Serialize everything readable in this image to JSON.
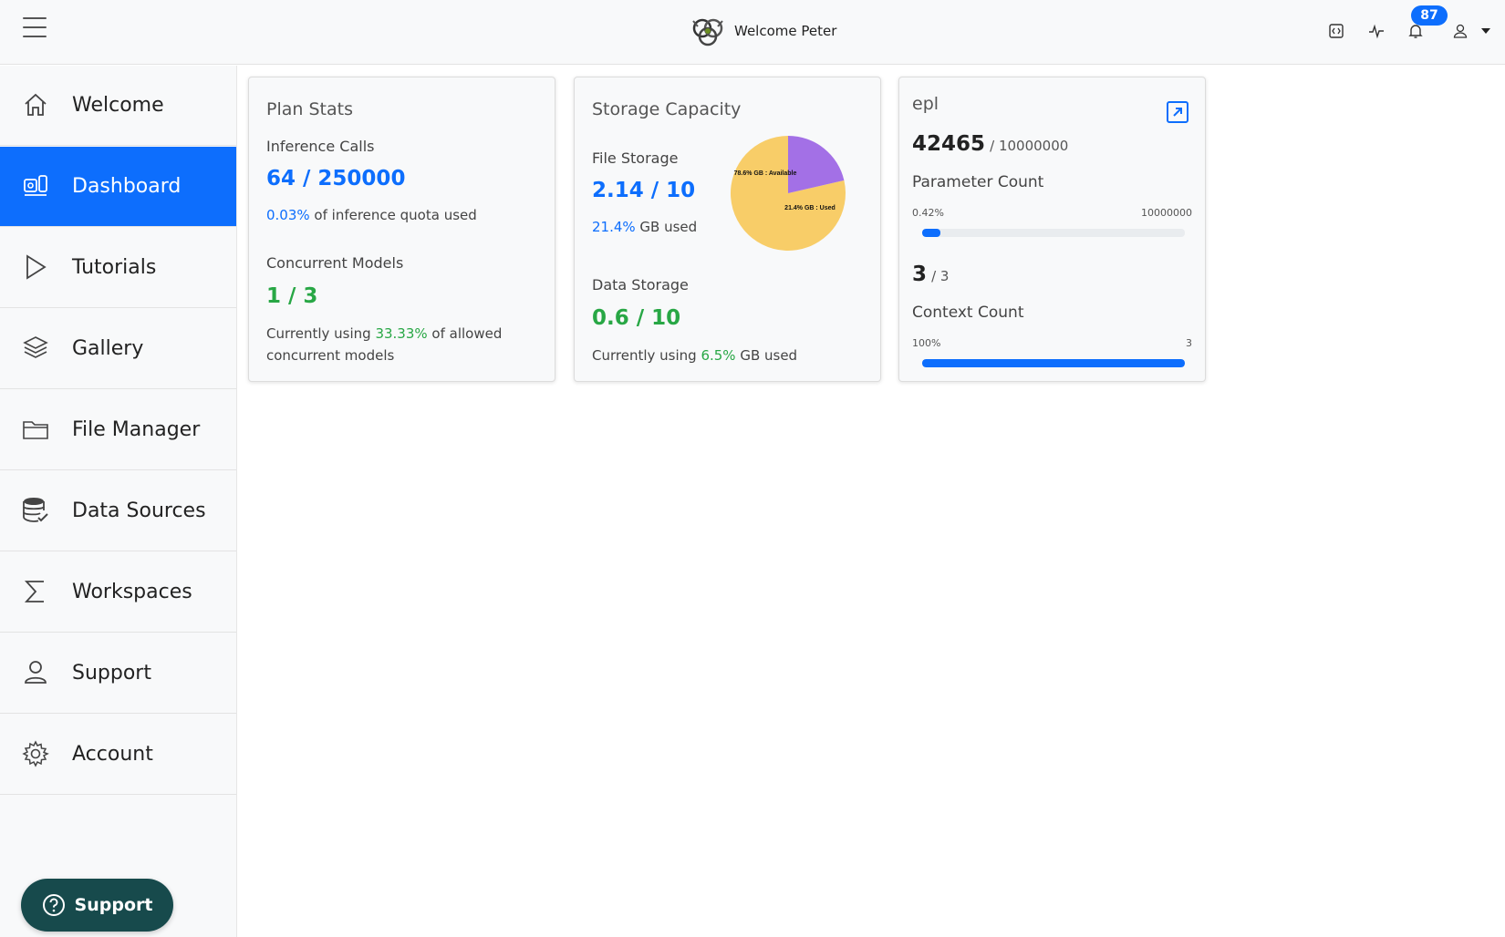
{
  "header": {
    "welcome_text": "Welcome Peter",
    "notification_count": "87",
    "accent_color": "#0d6efd"
  },
  "sidebar": {
    "items": [
      {
        "label": "Welcome",
        "icon": "home-icon"
      },
      {
        "label": "Dashboard",
        "icon": "dashboard-icon",
        "active": true
      },
      {
        "label": "Tutorials",
        "icon": "play-icon"
      },
      {
        "label": "Gallery",
        "icon": "layers-icon"
      },
      {
        "label": "File Manager",
        "icon": "folder-icon"
      },
      {
        "label": "Data Sources",
        "icon": "database-icon"
      },
      {
        "label": "Workspaces",
        "icon": "sigma-icon"
      },
      {
        "label": "Support",
        "icon": "user-icon"
      },
      {
        "label": "Account",
        "icon": "gear-icon"
      }
    ],
    "support_button": "Support"
  },
  "plan_stats": {
    "title": "Plan Stats",
    "inference_label": "Inference Calls",
    "inference_value": "64 / 250000",
    "inference_pct": "0.03%",
    "inference_pct_suffix": " of inference quota used",
    "concurrent_label": "Concurrent Models",
    "concurrent_value": "1 / 3",
    "concurrent_prefix": "Currently using ",
    "concurrent_pct": "33.33%",
    "concurrent_suffix_1": " of allowed",
    "concurrent_suffix_2": "concurrent models"
  },
  "storage": {
    "title": "Storage Capacity",
    "file_label": "File Storage",
    "file_value": "2.14 / 10",
    "file_pct": "21.4%",
    "file_suffix": " GB used",
    "data_label": "Data Storage",
    "data_value": "0.6 / 10",
    "data_prefix": "Currently using ",
    "data_pct": "6.5%",
    "data_suffix": " GB used"
  },
  "model": {
    "name": "epl",
    "param_value": "42465",
    "param_total": "/ 10000000",
    "param_label": "Parameter Count",
    "param_pct_label": "0.42%",
    "param_max_label": "10000000",
    "param_fraction": 0.042,
    "context_value": "3",
    "context_total": "/ 3",
    "context_label": "Context Count",
    "context_pct_label": "100%",
    "context_max_label": "3",
    "context_fraction": 1.0
  },
  "chart_data": {
    "type": "pie",
    "labels": [
      "78.6% GB : Available",
      "21.4% GB : Used"
    ],
    "values": [
      78.6,
      21.4
    ],
    "colors": [
      "#f8cd68",
      "#a370e6"
    ]
  }
}
